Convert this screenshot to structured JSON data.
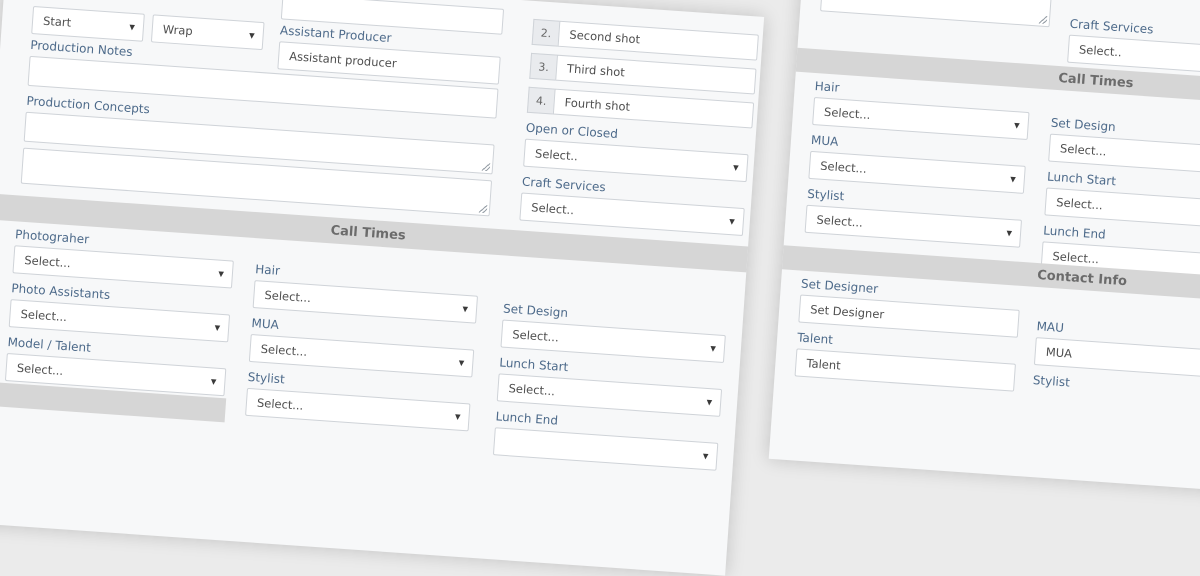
{
  "left_form": {
    "start_select": "Start",
    "wrap_select": "Wrap",
    "assistant_producer_label": "Assistant Producer",
    "assistant_producer_placeholder": "Assistant producer",
    "production_notes_label": "Production Notes",
    "production_concepts_label": "Production Concepts",
    "shots": [
      {
        "num": "2.",
        "text": "Second shot"
      },
      {
        "num": "3.",
        "text": "Third shot"
      },
      {
        "num": "4.",
        "text": "Fourth shot"
      }
    ],
    "open_closed_label": "Open or Closed",
    "open_closed_value": "Select..",
    "craft_services_label": "Craft Services",
    "craft_services_value": "Select..",
    "call_times_title": "Call Times",
    "photographer_label": "Photograher",
    "photographer_value": "Select...",
    "photo_assistants_label": "Photo Assistants",
    "photo_assistants_value": "Select...",
    "model_talent_label": "Model / Talent",
    "model_talent_value": "Select...",
    "hair_label": "Hair",
    "hair_value": "Select...",
    "mua_label": "MUA",
    "mua_value": "Select...",
    "stylist_label": "Stylist",
    "stylist_value": "Select...",
    "set_design_label": "Set Design",
    "set_design_value": "Select...",
    "lunch_start_label": "Lunch Start",
    "lunch_start_value": "Select...",
    "lunch_end_label": "Lunch End"
  },
  "right_form": {
    "craft_services_label": "Craft Services",
    "craft_services_value": "Select..",
    "call_times_title": "Call Times",
    "hair_label": "Hair",
    "hair_value": "Select...",
    "mua_label": "MUA",
    "mua_value": "Select...",
    "stylist_label": "Stylist",
    "stylist_value": "Select...",
    "set_design_label": "Set Design",
    "set_design_value": "Select...",
    "lunch_start_label": "Lunch Start",
    "lunch_start_value": "Select...",
    "lunch_end_label": "Lunch End",
    "lunch_end_value": "Select...",
    "contact_info_title": "Contact Info",
    "set_designer_label": "Set Designer",
    "set_designer_placeholder": "Set Designer",
    "mau_label": "MAU",
    "mau_placeholder": "MUA",
    "talent_label": "Talent",
    "talent_placeholder": "Talent",
    "stylist_contact_label": "Stylist"
  }
}
